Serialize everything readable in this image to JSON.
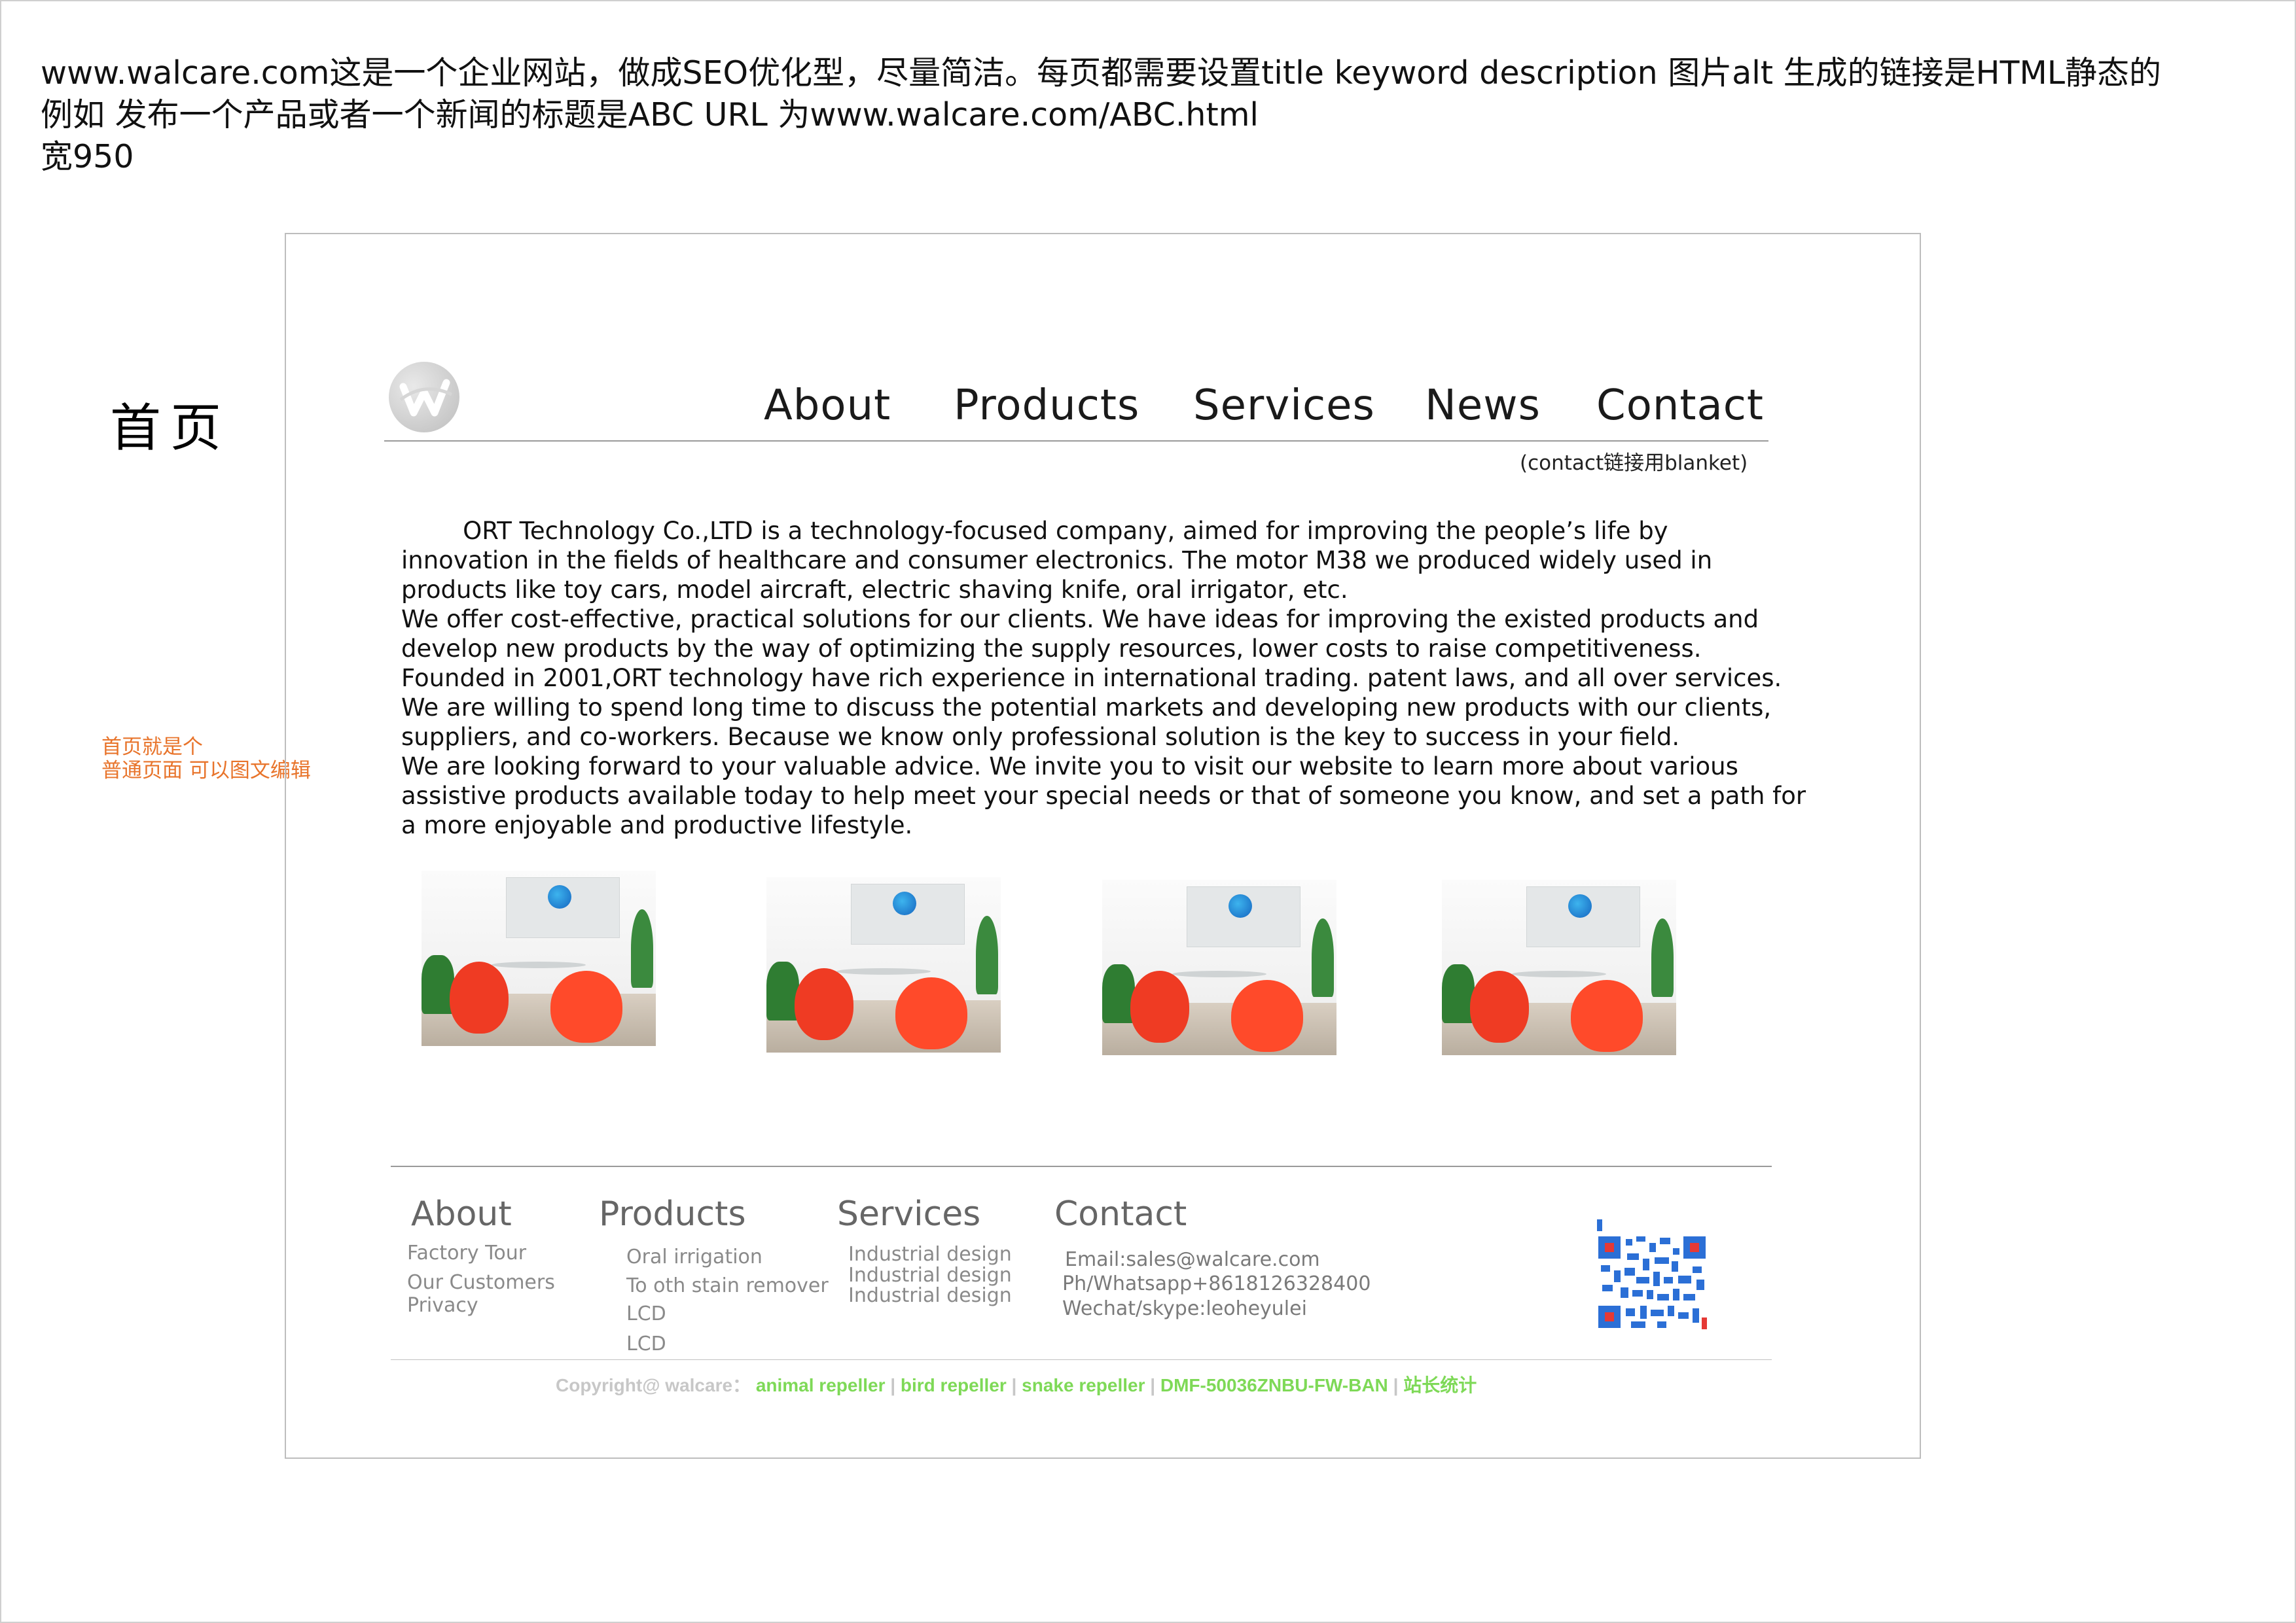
{
  "spec_notes": {
    "line1": "www.walcare.com这是一个企业网站，做成SEO优化型，尽量简洁。每页都需要设置title keyword description 图片alt  生成的链接是HTML静态的",
    "line2": "例如 发布一个产品或者一个新闻的标题是ABC URL 为www.walcare.com/ABC.html",
    "line3": "宽950"
  },
  "side": {
    "page_title": "首页",
    "note_line1": "首页就是个",
    "note_line2": "普通页面 可以图文编辑"
  },
  "nav": {
    "items": [
      "About",
      "Products",
      "Services",
      "News",
      "Contact"
    ],
    "contact_note": "(contact链接用blanket)"
  },
  "intro": {
    "paragraph_lines": [
      "        ORT Technology Co.,LTD is a technology-focused company, aimed for improving the people’s life by",
      "innovation in the fields of healthcare and consumer electronics. The motor M38 we produced widely used in",
      "products like toy cars, model aircraft, electric shaving knife, oral irrigator, etc.",
      "We offer cost-effective, practical solutions for our clients. We have ideas for improving the existed products and",
      "develop new products by the way of optimizing the supply resources, lower costs to raise competitiveness.",
      "Founded in 2001,ORT technology have rich experience in international trading. patent laws, and all over services.",
      "We are willing to spend long time to discuss the potential markets and developing new products with our clients,",
      "suppliers, and co-workers. Because we know only professional solution is the key to success in your field.",
      "We are looking forward to your valuable advice. We invite you to visit our website to learn more about various",
      "assistive products available today to help meet your special needs or that of someone you know, and set a path for",
      "a more enjoyable and productive lifestyle."
    ]
  },
  "footer": {
    "about": {
      "title": "About",
      "links": [
        "Factory Tour",
        "Our Customers",
        "Privacy"
      ]
    },
    "products": {
      "title": "Products",
      "links": [
        "Oral irrigation",
        "To oth stain remover",
        "LCD",
        "LCD"
      ]
    },
    "services": {
      "title": "Services",
      "links": [
        "Industrial design",
        "Industrial design",
        "Industrial design"
      ]
    },
    "contact": {
      "title": "Contact",
      "email": "Email:sales@walcare.com",
      "phone": "Ph/Whatsapp+8618126328400",
      "wechat": "Wechat/skype:leoheyulei"
    },
    "copyright": {
      "prefix": "Copyright@ walcare：",
      "links": [
        "animal repeller",
        "bird repeller",
        "snake repeller",
        "DMF-50036ZNBU-FW-BAN",
        "站长统计"
      ],
      "separator": " | "
    }
  },
  "colors": {
    "note_orange": "#e8742b",
    "copyright_green": "#7ed957",
    "qr_blue": "#2b6fd6"
  }
}
